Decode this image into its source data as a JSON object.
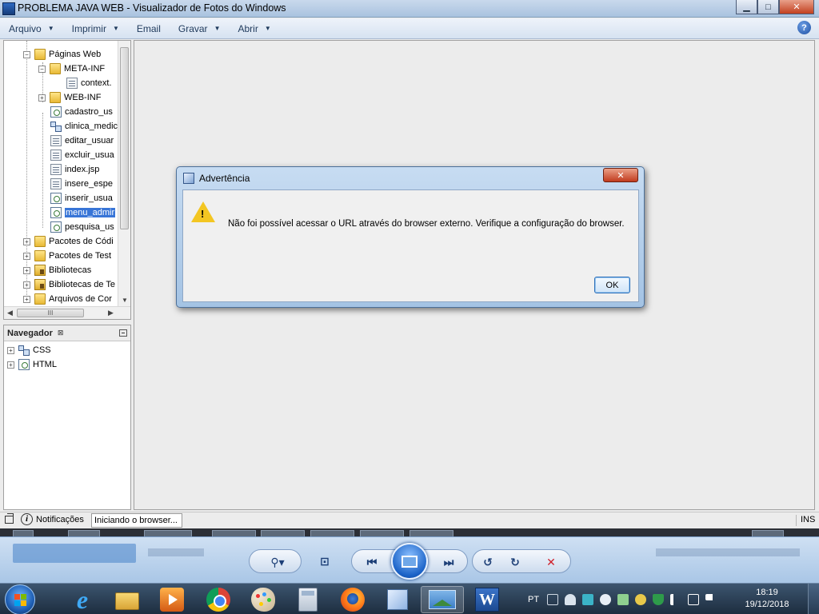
{
  "window": {
    "title": "PROBLEMA JAVA WEB - Visualizador de Fotos do Windows",
    "minimize": "▁",
    "maximize": "□",
    "close": "✕"
  },
  "menu": {
    "items": [
      {
        "label": "Arquivo",
        "has_caret": true
      },
      {
        "label": "Imprimir",
        "has_caret": true
      },
      {
        "label": "Email",
        "has_caret": false
      },
      {
        "label": "Gravar",
        "has_caret": true
      },
      {
        "label": "Abrir",
        "has_caret": true
      }
    ],
    "caret": "▼",
    "help": "?"
  },
  "project_tree": {
    "items": [
      {
        "label": "Páginas Web",
        "icon": "folder-icon"
      },
      {
        "label": "META-INF",
        "icon": "folder-icon"
      },
      {
        "label": "context.",
        "icon": "xml-file-icon"
      },
      {
        "label": "WEB-INF",
        "icon": "folder-icon"
      },
      {
        "label": "cadastro_us",
        "icon": "jsp-file-icon"
      },
      {
        "label": "clinica_medic",
        "icon": "css-file-icon"
      },
      {
        "label": "editar_usuar",
        "icon": "jsp-file-icon"
      },
      {
        "label": "excluir_usua",
        "icon": "jsp-file-icon"
      },
      {
        "label": "index.jsp",
        "icon": "jsp-file-icon"
      },
      {
        "label": "insere_espe",
        "icon": "jsp-file-icon"
      },
      {
        "label": "inserir_usua",
        "icon": "jsp-file-icon"
      },
      {
        "label": "menu_admir",
        "icon": "jsp-file-icon",
        "selected": true
      },
      {
        "label": "pesquisa_us",
        "icon": "jsp-file-icon"
      },
      {
        "label": "Pacotes de Códi",
        "icon": "package-folder-icon"
      },
      {
        "label": "Pacotes de Test",
        "icon": "package-folder-icon"
      },
      {
        "label": "Bibliotecas",
        "icon": "library-icon"
      },
      {
        "label": "Bibliotecas de Te",
        "icon": "library-icon"
      },
      {
        "label": "Arquivos de Cor",
        "icon": "folder-icon"
      }
    ],
    "hscroll_grip": "III"
  },
  "navigator": {
    "title": "Navegador",
    "close_glyph": "⊠",
    "items": [
      {
        "label": "CSS",
        "icon": "css-icon"
      },
      {
        "label": "HTML",
        "icon": "html-icon"
      }
    ]
  },
  "dialog": {
    "title": "Advertência",
    "message": "Não foi possível acessar o URL através do browser externo. Verifique a configuração do browser.",
    "ok": "OK",
    "close": "✕",
    "warn_mark": "!"
  },
  "status": {
    "notifications": "Notificações",
    "progress": "Iniciando o browser...",
    "mode": "INS"
  },
  "viewer_controls": {
    "zoom": "⚲▾",
    "fit": "⊡",
    "prev": "⏮",
    "next": "⏭",
    "rotate_left": "↺",
    "rotate_right": "↻",
    "delete": "✕"
  },
  "taskbar": {
    "language": "PT",
    "time": "18:19",
    "date": "19/12/2018"
  }
}
